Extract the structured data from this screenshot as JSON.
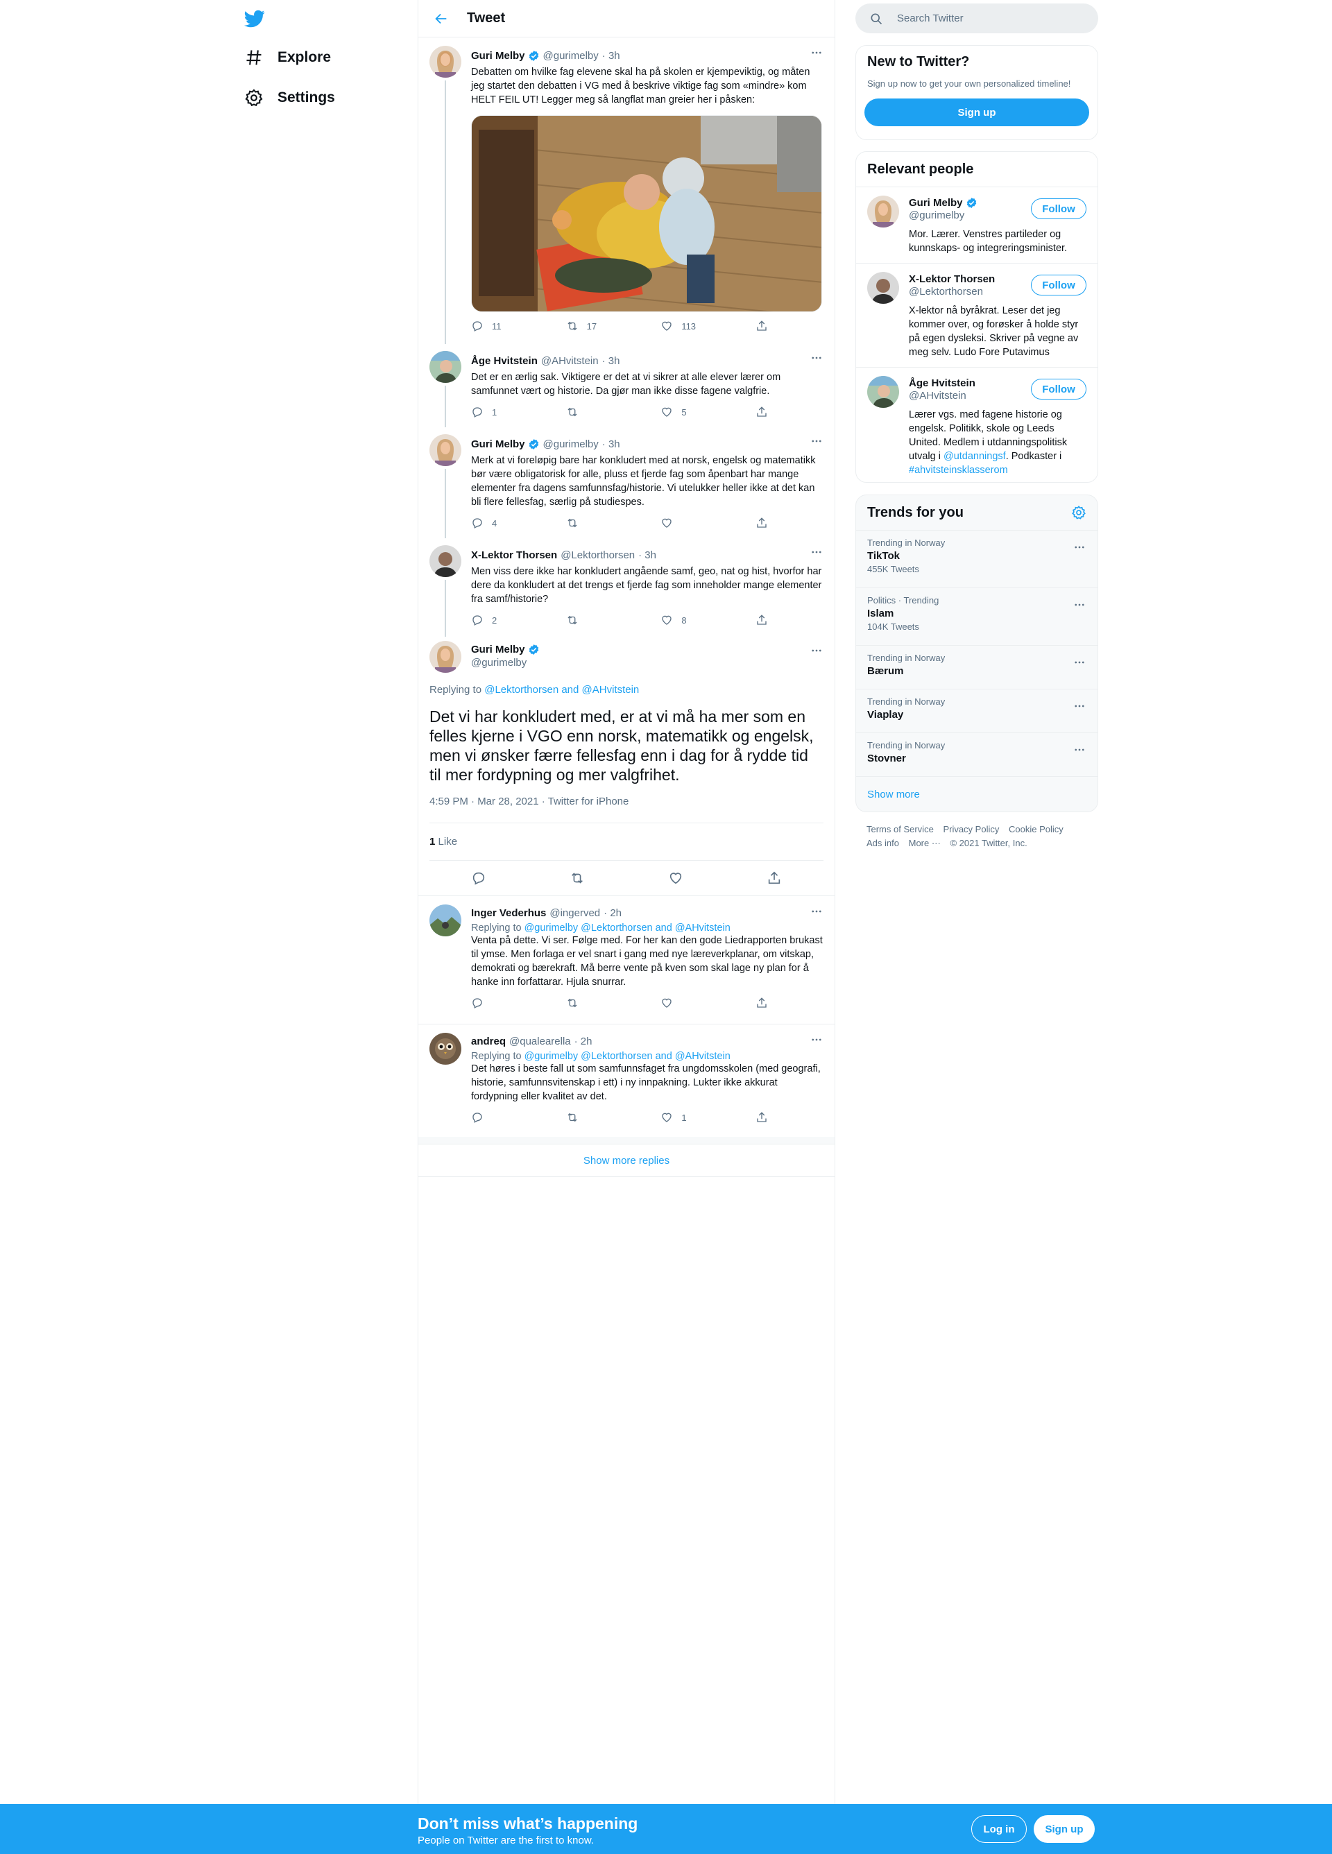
{
  "nav": {
    "explore": "Explore",
    "settings": "Settings"
  },
  "header": {
    "title": "Tweet"
  },
  "thread": [
    {
      "name": "Guri Melby",
      "handle": "@gurimelby",
      "time": "· 3h",
      "verified": true,
      "text": "Debatten om hvilke fag elevene skal ha på skolen er kjempeviktig, og måten jeg startet den debatten i VG med å beskrive viktige fag som «mindre» kom HELT FEIL UT! Legger meg så langflat man greier her i påsken:",
      "replies": "11",
      "retweets": "17",
      "likes": "113"
    },
    {
      "name": "Åge Hvitstein",
      "handle": "@AHvitstein",
      "time": "· 3h",
      "text": "Det er en ærlig sak. Viktigere er det at vi sikrer at alle elever lærer om samfunnet vært og historie. Da gjør man ikke disse fagene valgfrie.",
      "replies": "1",
      "retweets": "",
      "likes": "5"
    },
    {
      "name": "Guri Melby",
      "handle": "@gurimelby",
      "time": "· 3h",
      "verified": true,
      "text": "Merk at vi foreløpig bare har konkludert med at norsk, engelsk og matematikk bør være obligatorisk for alle, pluss et fjerde fag som åpenbart har mange elementer fra dagens samfunnsfag/historie. Vi utelukker heller ikke at det kan bli flere fellesfag, særlig på studiespes.",
      "replies": "4",
      "retweets": "",
      "likes": ""
    },
    {
      "name": "X-Lektor Thorsen",
      "handle": "@Lektorthorsen",
      "time": "· 3h",
      "text": "Men viss dere ikke har konkludert angående  samf, geo, nat og hist, hvorfor har dere da konkludert at det trengs et fjerde fag som inneholder mange elementer fra samf/historie?",
      "replies": "2",
      "retweets": "",
      "likes": "8"
    }
  ],
  "focus": {
    "name": "Guri Melby",
    "handle": "@gurimelby",
    "replying_prefix": "Replying to ",
    "replying_to": "@Lektorthorsen and @AHvitstein",
    "text": "Det vi har konkludert med, er at vi må ha mer som en felles kjerne i VGO enn norsk, matematikk og engelsk, men vi ønsker færre fellesfag enn i dag for å rydde tid til mer fordypning og mer valgfrihet.",
    "meta": "4:59 PM · Mar 28, 2021 · Twitter for iPhone",
    "like_count": "1",
    "like_label": "Like"
  },
  "replies": [
    {
      "name": "Inger Vederhus",
      "handle": "@ingerved",
      "time": "· 2h",
      "replying_prefix": "Replying to ",
      "replying_to": "@gurimelby @Lektorthorsen and @AHvitstein",
      "text": "Venta på dette. Vi ser. Følge med. For her kan den gode Liedrapporten brukast til ymse. Men forlaga er vel snart i gang med nye læreverkplanar, om vitskap, demokrati og bærekraft. Må berre vente på kven som skal lage ny plan for å hanke inn forfattarar. Hjula snurrar.",
      "replies": "",
      "retweets": "",
      "likes": ""
    },
    {
      "name": "andreq",
      "handle": "@qualearella",
      "time": "· 2h",
      "replying_prefix": "Replying to ",
      "replying_to": "@gurimelby @Lektorthorsen and @AHvitstein",
      "text": "Det høres i beste fall ut som samfunnsfaget fra ungdomsskolen (med geografi, historie, samfunnsvitenskap i ett) i ny innpakning. Lukter ikke akkurat fordypning eller kvalitet av det.",
      "replies": "",
      "retweets": "",
      "likes": "1"
    }
  ],
  "show_more_replies": "Show more replies",
  "search": {
    "placeholder": "Search Twitter"
  },
  "new_to_twitter": {
    "title": "New to Twitter?",
    "subtitle": "Sign up now to get your own personalized timeline!",
    "button": "Sign up"
  },
  "relevant_people": {
    "title": "Relevant people",
    "follow_label": "Follow",
    "people": [
      {
        "name": "Guri Melby",
        "handle": "@gurimelby",
        "bio": "Mor. Lærer. Venstres partileder og kunnskaps- og integreringsminister."
      },
      {
        "name": "X-Lektor Thorsen",
        "handle": "@Lektorthorsen",
        "bio": "X-lektor nå byråkrat. Leser det jeg kommer over, og forøsker å holde styr på egen dysleksi. Skriver på vegne av meg selv. Ludo Fore Putavimus"
      },
      {
        "name": "Åge Hvitstein",
        "handle": "@AHvitstein",
        "bio_pre": "Lærer vgs. med fagene historie og engelsk. Politikk, skole og Leeds United. Medlem i utdanningspolitisk utvalg i ",
        "bio_link1": "@utdanningsf",
        "bio_mid": ". Podkaster i ",
        "bio_link2": "#ahvitsteinsklasserom"
      }
    ]
  },
  "trends": {
    "title": "Trends for you",
    "items": [
      {
        "context": "Trending in Norway",
        "name": "TikTok",
        "count": "455K Tweets"
      },
      {
        "context": "Politics · Trending",
        "name": "Islam",
        "count": "104K Tweets"
      },
      {
        "context": "Trending in Norway",
        "name": "Bærum",
        "count": ""
      },
      {
        "context": "Trending in Norway",
        "name": "Viaplay",
        "count": ""
      },
      {
        "context": "Trending in Norway",
        "name": "Stovner",
        "count": ""
      }
    ],
    "show_more": "Show more"
  },
  "footer": {
    "terms": "Terms of Service",
    "privacy": "Privacy Policy",
    "cookie": "Cookie Policy",
    "ads": "Ads info",
    "more": "More ···",
    "copyright": "© 2021 Twitter, Inc."
  },
  "bottom_bar": {
    "title": "Don’t miss what’s happening",
    "subtitle": "People on Twitter are the first to know.",
    "login": "Log in",
    "signup": "Sign up"
  },
  "colors": {
    "accent": "#1da1f2",
    "text": "#0f1419",
    "muted": "#5b7083",
    "border": "#ebeef0"
  }
}
